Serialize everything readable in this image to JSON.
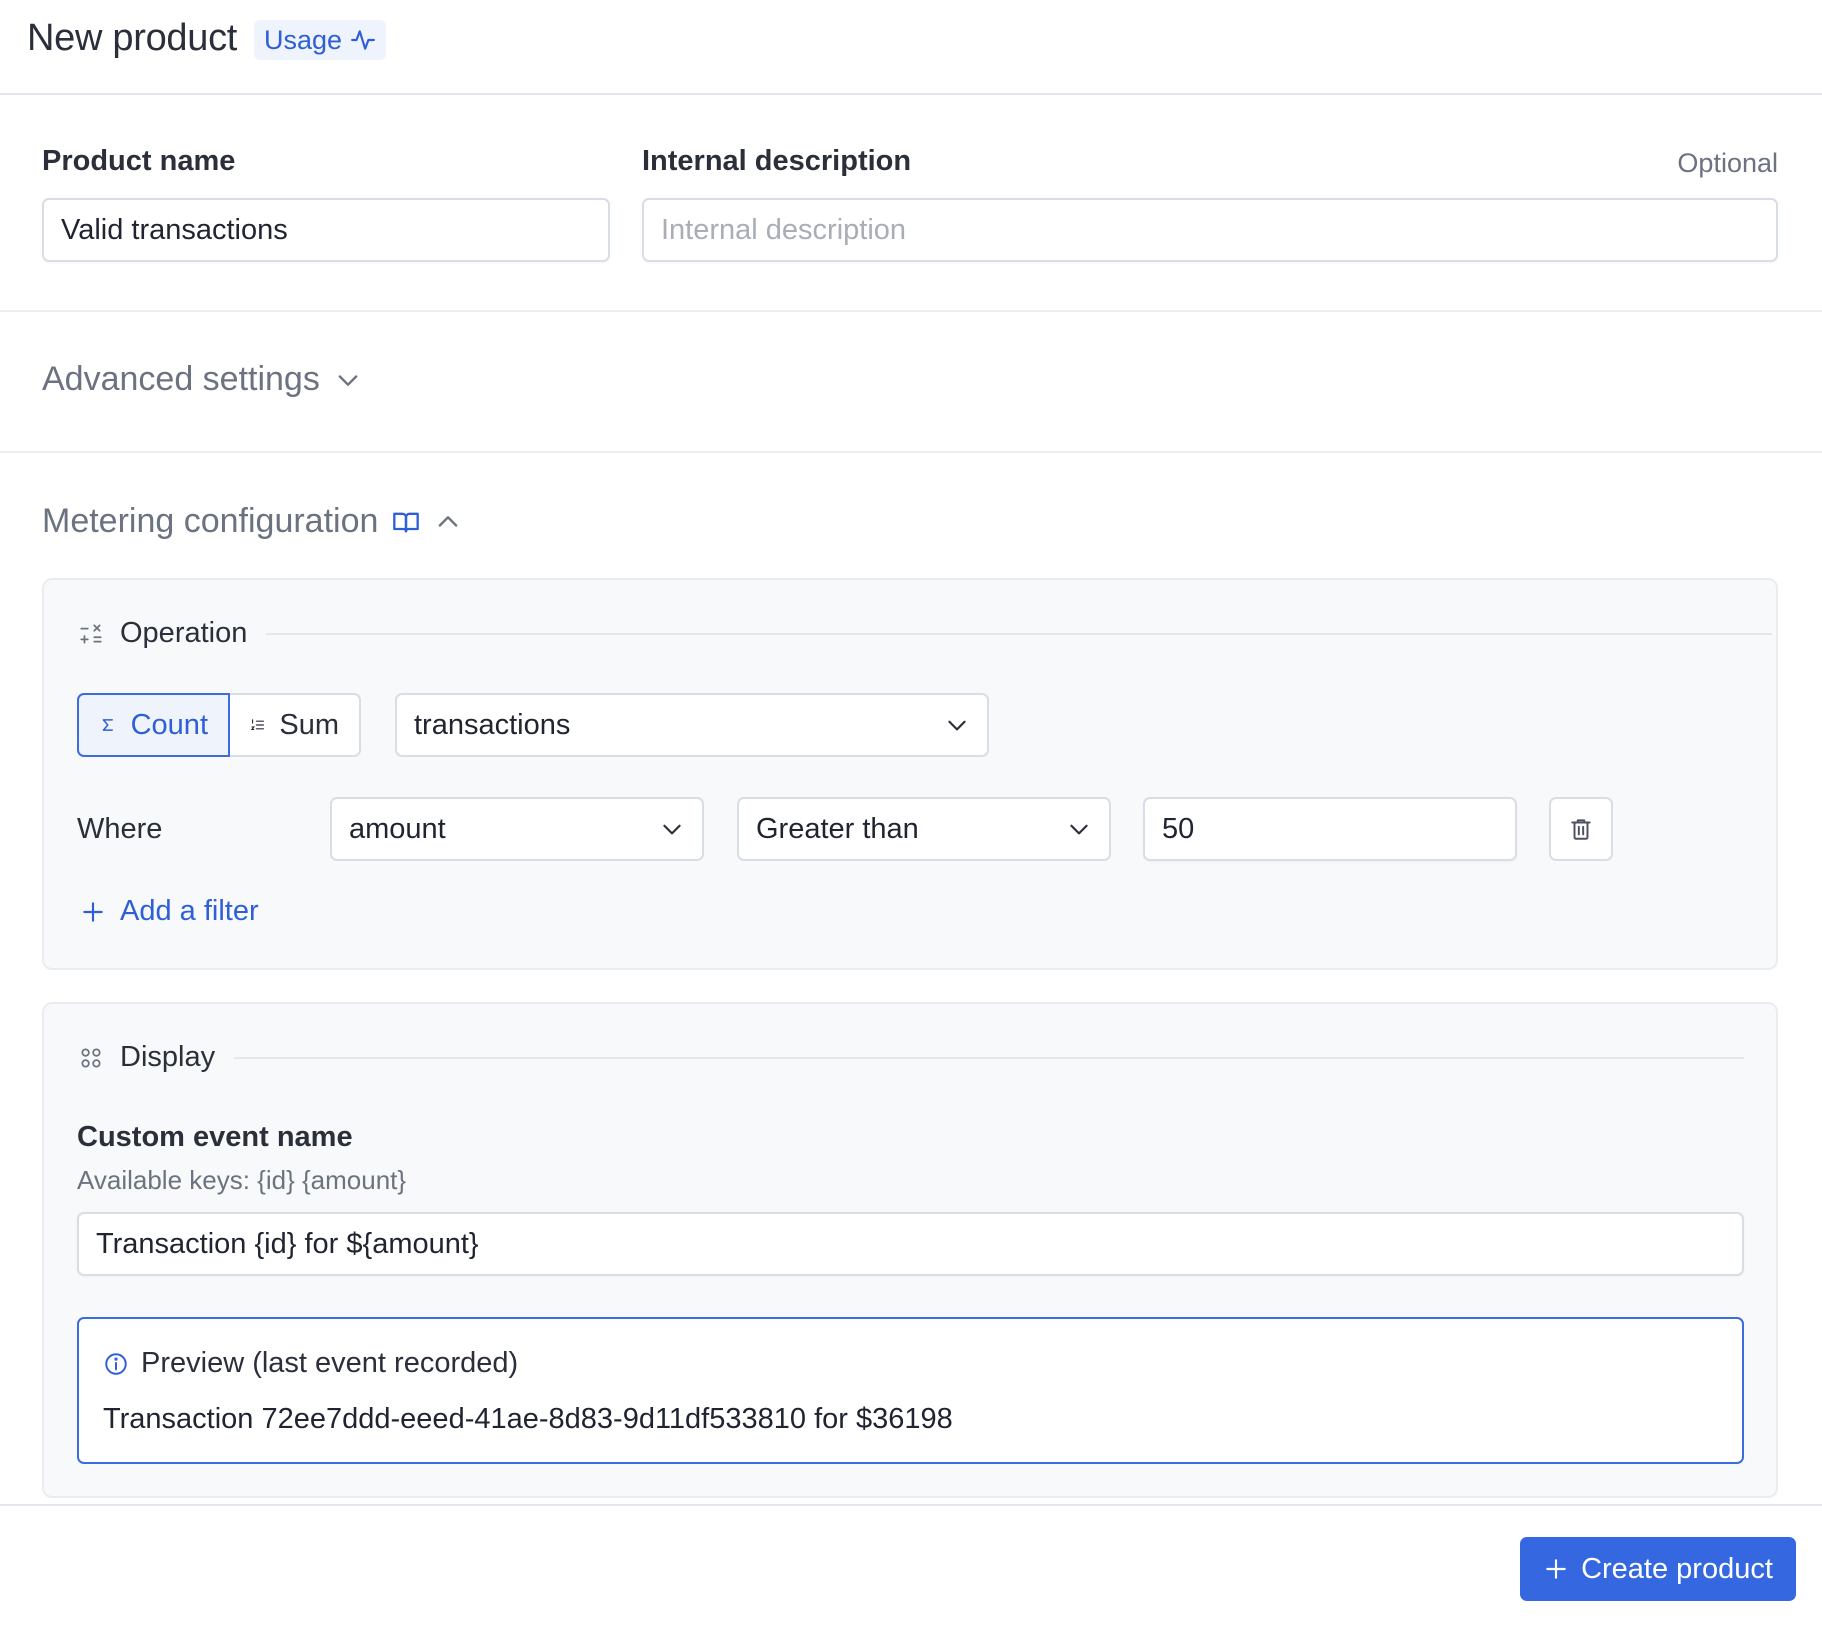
{
  "header": {
    "title": "New product",
    "badge": "Usage"
  },
  "form": {
    "product_name_label": "Product name",
    "product_name_value": "Valid transactions",
    "description_label": "Internal description",
    "description_optional": "Optional",
    "description_placeholder": "Internal description"
  },
  "advanced": {
    "title": "Advanced settings"
  },
  "metering": {
    "title": "Metering configuration",
    "operation": {
      "title": "Operation",
      "count_label": "Count",
      "sum_label": "Sum",
      "selected": "Count",
      "event_select": "transactions",
      "where_label": "Where",
      "filter_field": "amount",
      "filter_operator": "Greater than",
      "filter_value": "50",
      "add_filter_label": "Add a filter"
    },
    "display": {
      "title": "Display",
      "custom_event_label": "Custom event name",
      "available_keys": "Available keys: {id} {amount}",
      "custom_event_value": "Transaction {id} for ${amount}",
      "preview_title": "Preview (last event recorded)",
      "preview_text": "Transaction 72ee7ddd-eeed-41ae-8d83-9d11df533810 for $36198"
    }
  },
  "footer": {
    "create_label": "Create product"
  },
  "colors": {
    "accent": "#3467e0",
    "accent_text": "#2f5fd6",
    "muted": "#6b7280"
  }
}
